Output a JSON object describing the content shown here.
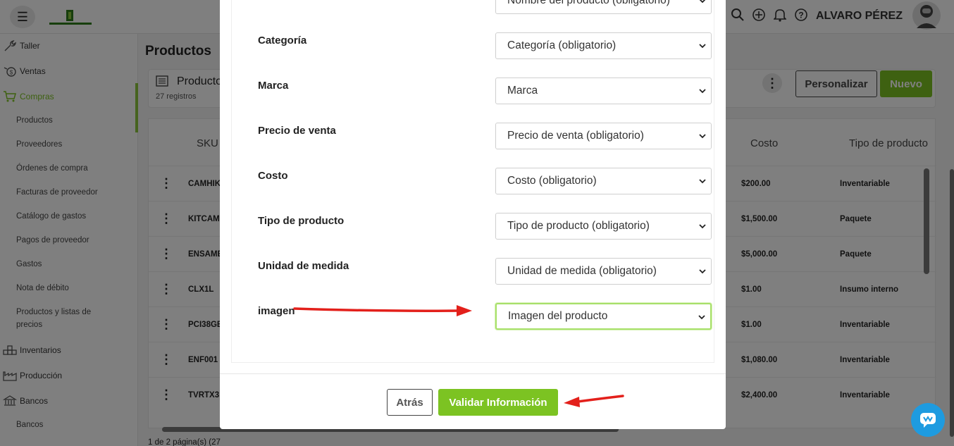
{
  "header": {
    "user_name": "ALVARO PÉREZ",
    "icons": [
      "menu-icon",
      "search-zoom-icon",
      "add-circle-icon",
      "bell-icon",
      "help-icon",
      "avatar"
    ]
  },
  "sidebar": {
    "sections": [
      {
        "label": "Taller",
        "icon": "wrench-icon"
      },
      {
        "label": "Ventas",
        "icon": "money-icon"
      },
      {
        "label": "Compras",
        "icon": "cart-icon",
        "active": true
      },
      {
        "label": "Inventarios",
        "icon": "boxes-icon"
      },
      {
        "label": "Producción",
        "icon": "factory-icon"
      },
      {
        "label": "Bancos",
        "icon": "bank-icon"
      }
    ],
    "compras_items": [
      "Productos",
      "Proveedores",
      "Órdenes de compra",
      "Facturas de proveedor",
      "Catálogo de gastos",
      "Pagos de proveedor",
      "Gastos",
      "Nota de débito",
      "Productos y listas de precios"
    ],
    "bancos_items": [
      "Bancos"
    ]
  },
  "main": {
    "page_title": "Productos",
    "card_title": "Producto",
    "records": "27 registros",
    "personalizar": "Personalizar",
    "nuevo": "Nuevo",
    "columns": {
      "sku": "SKU",
      "costo": "Costo",
      "tipo": "Tipo de producto"
    },
    "rows": [
      {
        "sku": "CAMHIK",
        "cost": "$200.00",
        "type": "Inventariable"
      },
      {
        "sku": "KITCAM",
        "cost": "$1,500.00",
        "type": "Paquete"
      },
      {
        "sku": "ENSAME",
        "cost": "$5,000.00",
        "type": "Paquete"
      },
      {
        "sku": "CLX1L",
        "cost": "$1.00",
        "type": "Insumo interno"
      },
      {
        "sku": "PCI38GB",
        "cost": "$1.00",
        "type": "Inventariable"
      },
      {
        "sku": "ENF001",
        "cost": "$1,080.00",
        "type": "Inventariable"
      },
      {
        "sku": "TVRTX3",
        "cost": "$2,400.00",
        "type": "Inventariable"
      }
    ],
    "pagination": "1 de 2 página(s) (27"
  },
  "modal": {
    "fields": [
      {
        "label": "",
        "value": "Nombre del producto (obligatorio)"
      },
      {
        "label": "Categoría",
        "value": "Categoría (obligatorio)"
      },
      {
        "label": "Marca",
        "value": "Marca"
      },
      {
        "label": "Precio de venta",
        "value": "Precio de venta (obligatorio)"
      },
      {
        "label": "Costo",
        "value": "Costo (obligatorio)"
      },
      {
        "label": "Tipo de producto",
        "value": "Tipo de producto (obligatorio)"
      },
      {
        "label": "Unidad de medida",
        "value": "Unidad de medida (obligatorio)"
      },
      {
        "label": "imagen",
        "value": "Imagen del producto"
      }
    ],
    "back_button": "Atrás",
    "validate_button": "Validar Información"
  },
  "colors": {
    "accent_green": "#7cc322",
    "arrow_red": "#e3201b",
    "chat_blue": "#1e9be0"
  }
}
